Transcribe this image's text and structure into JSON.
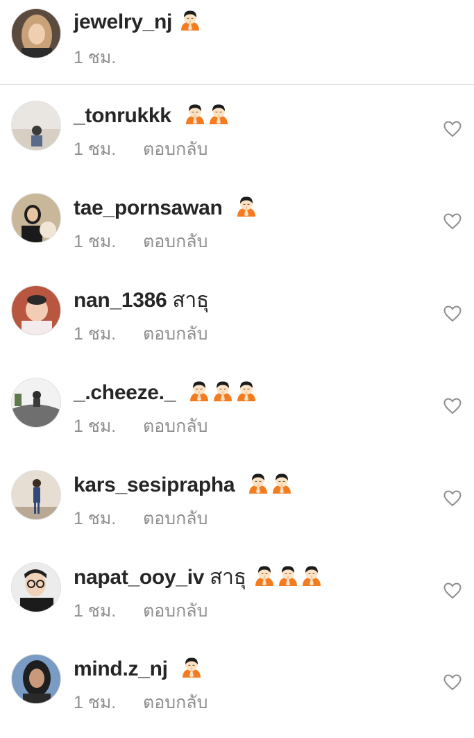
{
  "caption": {
    "username": "jewelry_nj",
    "emoji_count": 1,
    "time": "1 ชม."
  },
  "comments": [
    {
      "username": "_tonrukkk",
      "text": "",
      "emoji_count": 2,
      "time": "1 ชม.",
      "reply": "ตอบกลับ"
    },
    {
      "username": "tae_pornsawan",
      "text": "",
      "emoji_count": 1,
      "time": "1 ชม.",
      "reply": "ตอบกลับ"
    },
    {
      "username": "nan_1386",
      "text": "สาธุ",
      "emoji_count": 0,
      "time": "1 ชม.",
      "reply": "ตอบกลับ"
    },
    {
      "username": "_.cheeze._",
      "text": "",
      "emoji_count": 3,
      "time": "1 ชม.",
      "reply": "ตอบกลับ"
    },
    {
      "username": "kars_sesiprapha",
      "text": "",
      "emoji_count": 2,
      "time": "1 ชม.",
      "reply": "ตอบกลับ"
    },
    {
      "username": "napat_ooy_iv",
      "text": "สาธุ",
      "emoji_count": 3,
      "time": "1 ชม.",
      "reply": "ตอบกลับ"
    },
    {
      "username": "mind.z_nj",
      "text": "",
      "emoji_count": 1,
      "time": "1 ชม.",
      "reply": "ตอบกลับ"
    }
  ],
  "icons": {
    "emoji": "folded-hands-person-icon",
    "like": "heart-outline-icon"
  },
  "colors": {
    "text": "#262626",
    "secondary": "#8e8e8e",
    "divider": "#dbdbdb",
    "emoji_hoodie": "#f47c20",
    "emoji_hair": "#1c1c1c",
    "emoji_skin": "#fde3c4"
  }
}
